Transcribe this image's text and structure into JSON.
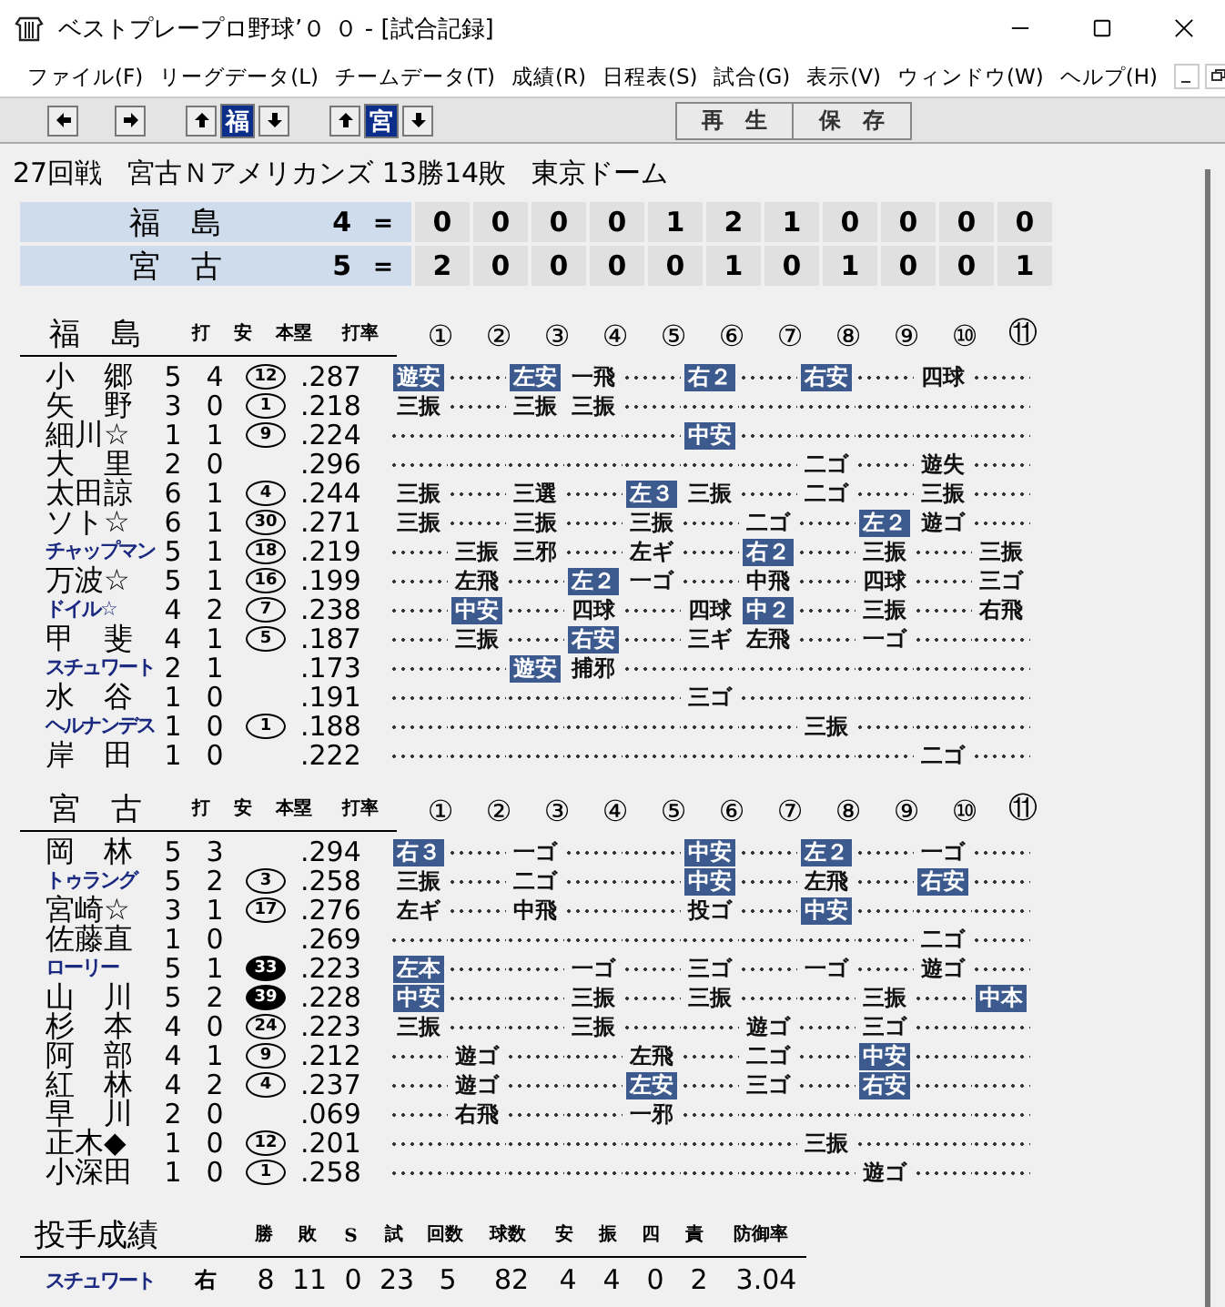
{
  "window": {
    "title": "ベストプレープロ野球’０ ０ - [試合記録]"
  },
  "menu": [
    "ファイル(F)",
    "リーグデータ(L)",
    "チームデータ(T)",
    "成績(R)",
    "日程表(S)",
    "試合(G)",
    "表示(V)",
    "ウィンドウ(W)",
    "ヘルプ(H)"
  ],
  "toolbar": {
    "team_buttons": [
      {
        "label": "福",
        "selected": true
      },
      {
        "label": "宮",
        "selected": true
      }
    ],
    "actions": [
      "再　生",
      "保　存"
    ]
  },
  "game": {
    "round": "27回戦",
    "series": "宮古Ｎアメリカンズ 13勝14敗",
    "stadium": "東京ドーム"
  },
  "scoreboard": [
    {
      "team": "福　島",
      "total": "4",
      "separator": "＝",
      "innings": [
        "0",
        "0",
        "0",
        "0",
        "1",
        "2",
        "1",
        "0",
        "0",
        "0",
        "0"
      ]
    },
    {
      "team": "宮　古",
      "total": "5",
      "separator": "＝",
      "innings": [
        "2",
        "0",
        "0",
        "0",
        "0",
        "1",
        "0",
        "1",
        "0",
        "0",
        "1"
      ]
    }
  ],
  "batting": [
    {
      "team": "福　島",
      "columns": [
        "打",
        "安",
        "本塁",
        "打率"
      ],
      "inning_headers": [
        "①",
        "②",
        "③",
        "④",
        "⑤",
        "⑥",
        "⑦",
        "⑧",
        "⑨",
        "⑩",
        "⑪"
      ],
      "players": [
        {
          "name": "小　郷",
          "kind": "kanji",
          "ab": "5",
          "h": "4",
          "hr": {
            "n": "12",
            "filled": false
          },
          "avg": ".287",
          "at_bats": [
            {
              "kind": "result",
              "r": "遊安",
              "hit": true
            },
            {
              "kind": "empty"
            },
            {
              "kind": "result",
              "r": "左安",
              "hit": true
            },
            {
              "kind": "result",
              "r": "一飛",
              "hit": false
            },
            {
              "kind": "empty"
            },
            {
              "kind": "result",
              "r": "右２",
              "hit": true
            },
            {
              "kind": "empty"
            },
            {
              "kind": "result",
              "r": "右安",
              "hit": true
            },
            {
              "kind": "empty"
            },
            {
              "kind": "result",
              "r": "四球",
              "hit": false
            },
            {
              "kind": "empty"
            }
          ]
        },
        {
          "name": "矢　野",
          "kind": "kanji",
          "ab": "3",
          "h": "0",
          "hr": {
            "n": "1",
            "filled": false
          },
          "avg": ".218",
          "at_bats": [
            {
              "kind": "result",
              "r": "三振",
              "hit": false
            },
            {
              "kind": "empty"
            },
            {
              "kind": "result",
              "r": "三振",
              "hit": false
            },
            {
              "kind": "result",
              "r": "三振",
              "hit": false
            },
            {
              "kind": "empty"
            },
            {
              "kind": "empty"
            },
            {
              "kind": "empty"
            },
            {
              "kind": "empty"
            },
            {
              "kind": "empty"
            },
            {
              "kind": "empty"
            },
            {
              "kind": "empty"
            }
          ]
        },
        {
          "name": "細川☆",
          "kind": "kanji",
          "ab": "1",
          "h": "1",
          "hr": {
            "n": "9",
            "filled": false
          },
          "avg": ".224",
          "at_bats": [
            {
              "kind": "empty"
            },
            {
              "kind": "empty"
            },
            {
              "kind": "empty"
            },
            {
              "kind": "empty"
            },
            {
              "kind": "empty"
            },
            {
              "kind": "result",
              "r": "中安",
              "hit": true
            },
            {
              "kind": "empty"
            },
            {
              "kind": "empty"
            },
            {
              "kind": "empty"
            },
            {
              "kind": "empty"
            },
            {
              "kind": "empty"
            }
          ]
        },
        {
          "name": "大　里",
          "kind": "kanji",
          "ab": "2",
          "h": "0",
          "avg": ".296",
          "at_bats": [
            {
              "kind": "empty"
            },
            {
              "kind": "empty"
            },
            {
              "kind": "empty"
            },
            {
              "kind": "empty"
            },
            {
              "kind": "empty"
            },
            {
              "kind": "empty"
            },
            {
              "kind": "empty"
            },
            {
              "kind": "result",
              "r": "二ゴ",
              "hit": false
            },
            {
              "kind": "empty"
            },
            {
              "kind": "result",
              "r": "遊失",
              "hit": false
            },
            {
              "kind": "empty"
            }
          ]
        },
        {
          "name": "太田諒",
          "kind": "kanji",
          "ab": "6",
          "h": "1",
          "hr": {
            "n": "4",
            "filled": false
          },
          "avg": ".244",
          "at_bats": [
            {
              "kind": "result",
              "r": "三振",
              "hit": false
            },
            {
              "kind": "empty"
            },
            {
              "kind": "result",
              "r": "三選",
              "hit": false
            },
            {
              "kind": "empty"
            },
            {
              "kind": "result",
              "r": "左３",
              "hit": true
            },
            {
              "kind": "result",
              "r": "三振",
              "hit": false
            },
            {
              "kind": "empty"
            },
            {
              "kind": "result",
              "r": "二ゴ",
              "hit": false
            },
            {
              "kind": "empty"
            },
            {
              "kind": "result",
              "r": "三振",
              "hit": false
            },
            {
              "kind": "empty"
            }
          ]
        },
        {
          "name": "ソト☆",
          "kind": "kanji",
          "ab": "6",
          "h": "1",
          "hr": {
            "n": "30",
            "filled": false
          },
          "avg": ".271",
          "at_bats": [
            {
              "kind": "result",
              "r": "三振",
              "hit": false
            },
            {
              "kind": "empty"
            },
            {
              "kind": "result",
              "r": "三振",
              "hit": false
            },
            {
              "kind": "empty"
            },
            {
              "kind": "result",
              "r": "三振",
              "hit": false
            },
            {
              "kind": "empty"
            },
            {
              "kind": "result",
              "r": "二ゴ",
              "hit": false
            },
            {
              "kind": "empty"
            },
            {
              "kind": "result",
              "r": "左２",
              "hit": true
            },
            {
              "kind": "result",
              "r": "遊ゴ",
              "hit": false
            },
            {
              "kind": "empty"
            }
          ]
        },
        {
          "name": "チャップマン",
          "kind": "katakana",
          "ab": "5",
          "h": "1",
          "hr": {
            "n": "18",
            "filled": false
          },
          "avg": ".219",
          "at_bats": [
            {
              "kind": "empty"
            },
            {
              "kind": "result",
              "r": "三振",
              "hit": false
            },
            {
              "kind": "result",
              "r": "三邪",
              "hit": false
            },
            {
              "kind": "empty"
            },
            {
              "kind": "result",
              "r": "左ギ",
              "hit": false
            },
            {
              "kind": "empty"
            },
            {
              "kind": "result",
              "r": "右２",
              "hit": true
            },
            {
              "kind": "empty"
            },
            {
              "kind": "result",
              "r": "三振",
              "hit": false
            },
            {
              "kind": "empty"
            },
            {
              "kind": "result",
              "r": "三振",
              "hit": false
            }
          ]
        },
        {
          "name": "万波☆",
          "kind": "kanji",
          "ab": "5",
          "h": "1",
          "hr": {
            "n": "16",
            "filled": false
          },
          "avg": ".199",
          "at_bats": [
            {
              "kind": "empty"
            },
            {
              "kind": "result",
              "r": "左飛",
              "hit": false
            },
            {
              "kind": "empty"
            },
            {
              "kind": "result",
              "r": "左２",
              "hit": true
            },
            {
              "kind": "result",
              "r": "一ゴ",
              "hit": false
            },
            {
              "kind": "empty"
            },
            {
              "kind": "result",
              "r": "中飛",
              "hit": false
            },
            {
              "kind": "empty"
            },
            {
              "kind": "result",
              "r": "四球",
              "hit": false
            },
            {
              "kind": "empty"
            },
            {
              "kind": "result",
              "r": "三ゴ",
              "hit": false
            }
          ]
        },
        {
          "name": "ドイル☆",
          "kind": "katakana",
          "ab": "4",
          "h": "2",
          "hr": {
            "n": "7",
            "filled": false
          },
          "avg": ".238",
          "at_bats": [
            {
              "kind": "empty"
            },
            {
              "kind": "result",
              "r": "中安",
              "hit": true
            },
            {
              "kind": "empty"
            },
            {
              "kind": "result",
              "r": "四球",
              "hit": false
            },
            {
              "kind": "empty"
            },
            {
              "kind": "result",
              "r": "四球",
              "hit": false
            },
            {
              "kind": "result",
              "r": "中２",
              "hit": true
            },
            {
              "kind": "empty"
            },
            {
              "kind": "result",
              "r": "三振",
              "hit": false
            },
            {
              "kind": "empty"
            },
            {
              "kind": "result",
              "r": "右飛",
              "hit": false
            }
          ]
        },
        {
          "name": "甲　斐",
          "kind": "kanji",
          "ab": "4",
          "h": "1",
          "hr": {
            "n": "5",
            "filled": false
          },
          "avg": ".187",
          "at_bats": [
            {
              "kind": "empty"
            },
            {
              "kind": "result",
              "r": "三振",
              "hit": false
            },
            {
              "kind": "empty"
            },
            {
              "kind": "result",
              "r": "右安",
              "hit": true
            },
            {
              "kind": "empty"
            },
            {
              "kind": "result",
              "r": "三ギ",
              "hit": false
            },
            {
              "kind": "result",
              "r": "左飛",
              "hit": false
            },
            {
              "kind": "empty"
            },
            {
              "kind": "result",
              "r": "一ゴ",
              "hit": false
            },
            {
              "kind": "empty"
            },
            {
              "kind": "empty"
            }
          ]
        },
        {
          "name": "スチュワート",
          "kind": "katakana",
          "ab": "2",
          "h": "1",
          "avg": ".173",
          "at_bats": [
            {
              "kind": "empty"
            },
            {
              "kind": "empty"
            },
            {
              "kind": "result",
              "r": "遊安",
              "hit": true
            },
            {
              "kind": "result",
              "r": "捕邪",
              "hit": false
            },
            {
              "kind": "empty"
            },
            {
              "kind": "empty"
            },
            {
              "kind": "empty"
            },
            {
              "kind": "empty"
            },
            {
              "kind": "empty"
            },
            {
              "kind": "empty"
            },
            {
              "kind": "empty"
            }
          ]
        },
        {
          "name": "水　谷",
          "kind": "kanji",
          "ab": "1",
          "h": "0",
          "avg": ".191",
          "at_bats": [
            {
              "kind": "empty"
            },
            {
              "kind": "empty"
            },
            {
              "kind": "empty"
            },
            {
              "kind": "empty"
            },
            {
              "kind": "empty"
            },
            {
              "kind": "result",
              "r": "三ゴ",
              "hit": false
            },
            {
              "kind": "empty"
            },
            {
              "kind": "empty"
            },
            {
              "kind": "empty"
            },
            {
              "kind": "empty"
            },
            {
              "kind": "empty"
            }
          ]
        },
        {
          "name": "ヘルナンデス",
          "kind": "katakana",
          "ab": "1",
          "h": "0",
          "hr": {
            "n": "1",
            "filled": false
          },
          "avg": ".188",
          "at_bats": [
            {
              "kind": "empty"
            },
            {
              "kind": "empty"
            },
            {
              "kind": "empty"
            },
            {
              "kind": "empty"
            },
            {
              "kind": "empty"
            },
            {
              "kind": "empty"
            },
            {
              "kind": "empty"
            },
            {
              "kind": "result",
              "r": "三振",
              "hit": false
            },
            {
              "kind": "empty"
            },
            {
              "kind": "empty"
            },
            {
              "kind": "empty"
            }
          ]
        },
        {
          "name": "岸　田",
          "kind": "kanji",
          "ab": "1",
          "h": "0",
          "avg": ".222",
          "at_bats": [
            {
              "kind": "empty"
            },
            {
              "kind": "empty"
            },
            {
              "kind": "empty"
            },
            {
              "kind": "empty"
            },
            {
              "kind": "empty"
            },
            {
              "kind": "empty"
            },
            {
              "kind": "empty"
            },
            {
              "kind": "empty"
            },
            {
              "kind": "empty"
            },
            {
              "kind": "result",
              "r": "二ゴ",
              "hit": false
            },
            {
              "kind": "empty"
            }
          ]
        }
      ]
    },
    {
      "team": "宮　古",
      "columns": [
        "打",
        "安",
        "本塁",
        "打率"
      ],
      "inning_headers": [
        "①",
        "②",
        "③",
        "④",
        "⑤",
        "⑥",
        "⑦",
        "⑧",
        "⑨",
        "⑩",
        "⑪"
      ],
      "players": [
        {
          "name": "岡　林",
          "kind": "kanji",
          "ab": "5",
          "h": "3",
          "avg": ".294",
          "at_bats": [
            {
              "kind": "result",
              "r": "右３",
              "hit": true
            },
            {
              "kind": "empty"
            },
            {
              "kind": "result",
              "r": "一ゴ",
              "hit": false
            },
            {
              "kind": "empty"
            },
            {
              "kind": "empty"
            },
            {
              "kind": "result",
              "r": "中安",
              "hit": true
            },
            {
              "kind": "empty"
            },
            {
              "kind": "result",
              "r": "左２",
              "hit": true
            },
            {
              "kind": "empty"
            },
            {
              "kind": "result",
              "r": "一ゴ",
              "hit": false
            },
            {
              "kind": "empty"
            }
          ]
        },
        {
          "name": "トゥラング",
          "kind": "katakana",
          "ab": "5",
          "h": "2",
          "hr": {
            "n": "3",
            "filled": false
          },
          "avg": ".258",
          "at_bats": [
            {
              "kind": "result",
              "r": "三振",
              "hit": false
            },
            {
              "kind": "empty"
            },
            {
              "kind": "result",
              "r": "二ゴ",
              "hit": false
            },
            {
              "kind": "empty"
            },
            {
              "kind": "empty"
            },
            {
              "kind": "result",
              "r": "中安",
              "hit": true
            },
            {
              "kind": "empty"
            },
            {
              "kind": "result",
              "r": "左飛",
              "hit": false
            },
            {
              "kind": "empty"
            },
            {
              "kind": "result",
              "r": "右安",
              "hit": true
            },
            {
              "kind": "empty"
            }
          ]
        },
        {
          "name": "宮崎☆",
          "kind": "kanji",
          "ab": "3",
          "h": "1",
          "hr": {
            "n": "17",
            "filled": false
          },
          "avg": ".276",
          "at_bats": [
            {
              "kind": "result",
              "r": "左ギ",
              "hit": false
            },
            {
              "kind": "empty"
            },
            {
              "kind": "result",
              "r": "中飛",
              "hit": false
            },
            {
              "kind": "empty"
            },
            {
              "kind": "empty"
            },
            {
              "kind": "result",
              "r": "投ゴ",
              "hit": false
            },
            {
              "kind": "empty"
            },
            {
              "kind": "result",
              "r": "中安",
              "hit": true
            },
            {
              "kind": "empty"
            },
            {
              "kind": "empty"
            },
            {
              "kind": "empty"
            }
          ]
        },
        {
          "name": "佐藤直",
          "kind": "kanji",
          "ab": "1",
          "h": "0",
          "avg": ".269",
          "at_bats": [
            {
              "kind": "empty"
            },
            {
              "kind": "empty"
            },
            {
              "kind": "empty"
            },
            {
              "kind": "empty"
            },
            {
              "kind": "empty"
            },
            {
              "kind": "empty"
            },
            {
              "kind": "empty"
            },
            {
              "kind": "empty"
            },
            {
              "kind": "empty"
            },
            {
              "kind": "result",
              "r": "二ゴ",
              "hit": false
            },
            {
              "kind": "empty"
            }
          ]
        },
        {
          "name": "ローリー",
          "kind": "katakana",
          "ab": "5",
          "h": "1",
          "hr": {
            "n": "33",
            "filled": true
          },
          "avg": ".223",
          "at_bats": [
            {
              "kind": "result",
              "r": "左本",
              "hit": true
            },
            {
              "kind": "empty"
            },
            {
              "kind": "empty"
            },
            {
              "kind": "result",
              "r": "一ゴ",
              "hit": false
            },
            {
              "kind": "empty"
            },
            {
              "kind": "result",
              "r": "三ゴ",
              "hit": false
            },
            {
              "kind": "empty"
            },
            {
              "kind": "result",
              "r": "一ゴ",
              "hit": false
            },
            {
              "kind": "empty"
            },
            {
              "kind": "result",
              "r": "遊ゴ",
              "hit": false
            },
            {
              "kind": "empty"
            }
          ]
        },
        {
          "name": "山　川",
          "kind": "kanji",
          "ab": "5",
          "h": "2",
          "hr": {
            "n": "39",
            "filled": true
          },
          "avg": ".228",
          "at_bats": [
            {
              "kind": "result",
              "r": "中安",
              "hit": true
            },
            {
              "kind": "empty"
            },
            {
              "kind": "empty"
            },
            {
              "kind": "result",
              "r": "三振",
              "hit": false
            },
            {
              "kind": "empty"
            },
            {
              "kind": "result",
              "r": "三振",
              "hit": false
            },
            {
              "kind": "empty"
            },
            {
              "kind": "empty"
            },
            {
              "kind": "result",
              "r": "三振",
              "hit": false
            },
            {
              "kind": "empty"
            },
            {
              "kind": "result",
              "r": "中本",
              "hit": true
            }
          ]
        },
        {
          "name": "杉　本",
          "kind": "kanji",
          "ab": "4",
          "h": "0",
          "hr": {
            "n": "24",
            "filled": false
          },
          "avg": ".223",
          "at_bats": [
            {
              "kind": "result",
              "r": "三振",
              "hit": false
            },
            {
              "kind": "empty"
            },
            {
              "kind": "empty"
            },
            {
              "kind": "result",
              "r": "三振",
              "hit": false
            },
            {
              "kind": "empty"
            },
            {
              "kind": "empty"
            },
            {
              "kind": "result",
              "r": "遊ゴ",
              "hit": false
            },
            {
              "kind": "empty"
            },
            {
              "kind": "result",
              "r": "三ゴ",
              "hit": false
            },
            {
              "kind": "empty"
            },
            {
              "kind": "empty"
            }
          ]
        },
        {
          "name": "阿　部",
          "kind": "kanji",
          "ab": "4",
          "h": "1",
          "hr": {
            "n": "9",
            "filled": false
          },
          "avg": ".212",
          "at_bats": [
            {
              "kind": "empty"
            },
            {
              "kind": "result",
              "r": "遊ゴ",
              "hit": false
            },
            {
              "kind": "empty"
            },
            {
              "kind": "empty"
            },
            {
              "kind": "result",
              "r": "左飛",
              "hit": false
            },
            {
              "kind": "empty"
            },
            {
              "kind": "result",
              "r": "二ゴ",
              "hit": false
            },
            {
              "kind": "empty"
            },
            {
              "kind": "result",
              "r": "中安",
              "hit": true
            },
            {
              "kind": "empty"
            },
            {
              "kind": "empty"
            }
          ]
        },
        {
          "name": "紅　林",
          "kind": "kanji",
          "ab": "4",
          "h": "2",
          "hr": {
            "n": "4",
            "filled": false
          },
          "avg": ".237",
          "at_bats": [
            {
              "kind": "empty"
            },
            {
              "kind": "result",
              "r": "遊ゴ",
              "hit": false
            },
            {
              "kind": "empty"
            },
            {
              "kind": "empty"
            },
            {
              "kind": "result",
              "r": "左安",
              "hit": true
            },
            {
              "kind": "empty"
            },
            {
              "kind": "result",
              "r": "三ゴ",
              "hit": false
            },
            {
              "kind": "empty"
            },
            {
              "kind": "result",
              "r": "右安",
              "hit": true
            },
            {
              "kind": "empty"
            },
            {
              "kind": "empty"
            }
          ]
        },
        {
          "name": "早　川",
          "kind": "kanji",
          "ab": "2",
          "h": "0",
          "avg": ".069",
          "at_bats": [
            {
              "kind": "empty"
            },
            {
              "kind": "result",
              "r": "右飛",
              "hit": false
            },
            {
              "kind": "empty"
            },
            {
              "kind": "empty"
            },
            {
              "kind": "result",
              "r": "一邪",
              "hit": false
            },
            {
              "kind": "empty"
            },
            {
              "kind": "empty"
            },
            {
              "kind": "empty"
            },
            {
              "kind": "empty"
            },
            {
              "kind": "empty"
            },
            {
              "kind": "empty"
            }
          ]
        },
        {
          "name": "正木◆",
          "kind": "kanji",
          "ab": "1",
          "h": "0",
          "hr": {
            "n": "12",
            "filled": false
          },
          "avg": ".201",
          "at_bats": [
            {
              "kind": "empty"
            },
            {
              "kind": "empty"
            },
            {
              "kind": "empty"
            },
            {
              "kind": "empty"
            },
            {
              "kind": "empty"
            },
            {
              "kind": "empty"
            },
            {
              "kind": "empty"
            },
            {
              "kind": "result",
              "r": "三振",
              "hit": false
            },
            {
              "kind": "empty"
            },
            {
              "kind": "empty"
            },
            {
              "kind": "empty"
            }
          ]
        },
        {
          "name": "小深田",
          "kind": "kanji",
          "ab": "1",
          "h": "0",
          "hr": {
            "n": "1",
            "filled": false
          },
          "avg": ".258",
          "at_bats": [
            {
              "kind": "empty"
            },
            {
              "kind": "empty"
            },
            {
              "kind": "empty"
            },
            {
              "kind": "empty"
            },
            {
              "kind": "empty"
            },
            {
              "kind": "empty"
            },
            {
              "kind": "empty"
            },
            {
              "kind": "empty"
            },
            {
              "kind": "result",
              "r": "遊ゴ",
              "hit": false
            },
            {
              "kind": "empty"
            },
            {
              "kind": "empty"
            }
          ]
        }
      ]
    }
  ],
  "pitching": {
    "title": "投手成績",
    "columns": [
      "勝",
      "敗",
      "S",
      "試",
      "回数",
      "球数",
      "安",
      "振",
      "四",
      "責",
      "防御率"
    ],
    "rows": [
      {
        "name": "スチュワート",
        "kind": "katakana",
        "throws": "右",
        "stats": [
          "8",
          "11",
          "0",
          "23",
          "5",
          "82",
          "4",
          "4",
          "0",
          "2",
          "3.04"
        ]
      }
    ]
  }
}
